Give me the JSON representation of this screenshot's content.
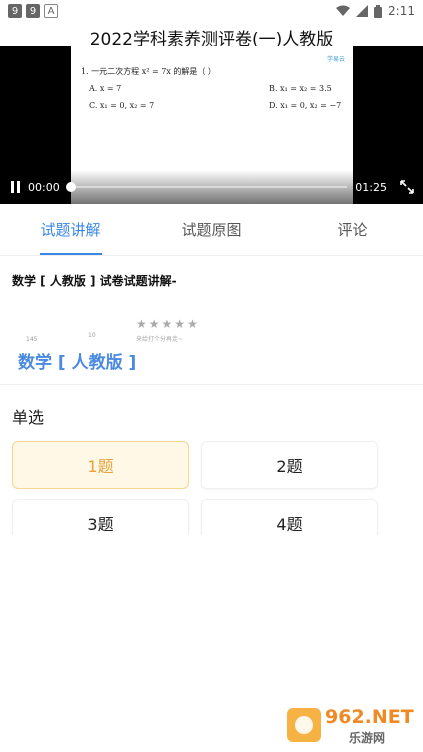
{
  "status_bar": {
    "notifications": [
      "9",
      "9",
      "A"
    ],
    "time": "2:11"
  },
  "video": {
    "title": "2022学科素养测评卷(一)人教版",
    "question_line": "1. 一元二次方程 x² = 7x 的解是（     ）",
    "option_a": "A. x = 7",
    "option_b": "B. x₁ = x₂ = 3.5",
    "option_c": "C. x₁ = 0, x₂ = 7",
    "option_d": "D. x₁ = 0, x₂ = −7",
    "logo_text": "学易云",
    "current_time": "00:00",
    "duration": "01:25",
    "progress": 0
  },
  "tabs": [
    {
      "label": "试题讲解",
      "active": true
    },
    {
      "label": "试题原图",
      "active": false
    },
    {
      "label": "评论",
      "active": false
    }
  ],
  "detail": {
    "section_title": "数学 [ 人教版 ] 试卷试题讲解-",
    "thumb_num_1": "145",
    "thumb_num_2": "10",
    "rating_hint": "来给打个分再走~",
    "book_name": "数学 [ 人教版 ]",
    "rating_stars": 0
  },
  "questions": {
    "type_label": "单选",
    "items": [
      "1题",
      "2题",
      "3题",
      "4题"
    ],
    "selected_index": 0
  },
  "watermark": {
    "top": "962.NET",
    "bottom": "乐游网"
  },
  "colors": {
    "accent": "#3a87e6",
    "selected_text": "#e6a23c",
    "selected_bg": "#fff8e7"
  }
}
